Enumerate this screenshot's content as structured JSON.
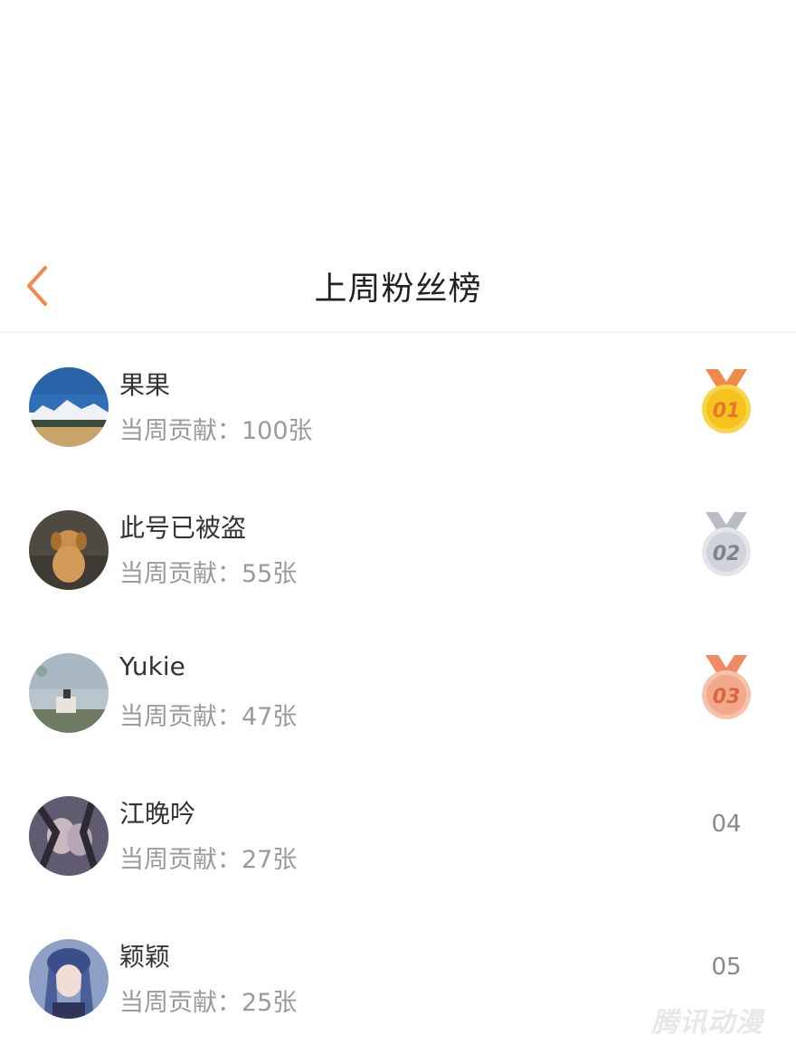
{
  "header": {
    "title": "上周粉丝榜"
  },
  "contribution_label": "当周贡献：",
  "unit": "张",
  "fans": [
    {
      "name": "果果",
      "contribution": "当周贡献：100张",
      "rank": "01",
      "rank_style": "gold"
    },
    {
      "name": "此号已被盗",
      "contribution": "当周贡献：55张",
      "rank": "02",
      "rank_style": "silver"
    },
    {
      "name": "Yukie",
      "contribution": "当周贡献：47张",
      "rank": "03",
      "rank_style": "bronze"
    },
    {
      "name": "江晚吟",
      "contribution": "当周贡献：27张",
      "rank": "04",
      "rank_style": "plain"
    },
    {
      "name": "颖颖",
      "contribution": "当周贡献：25张",
      "rank": "05",
      "rank_style": "plain"
    }
  ],
  "colors": {
    "accent": "#f08a4b",
    "gold": "#f6c21c",
    "silver": "#c9ccd3",
    "bronze": "#f0a98a"
  },
  "watermark": "腾讯动漫"
}
